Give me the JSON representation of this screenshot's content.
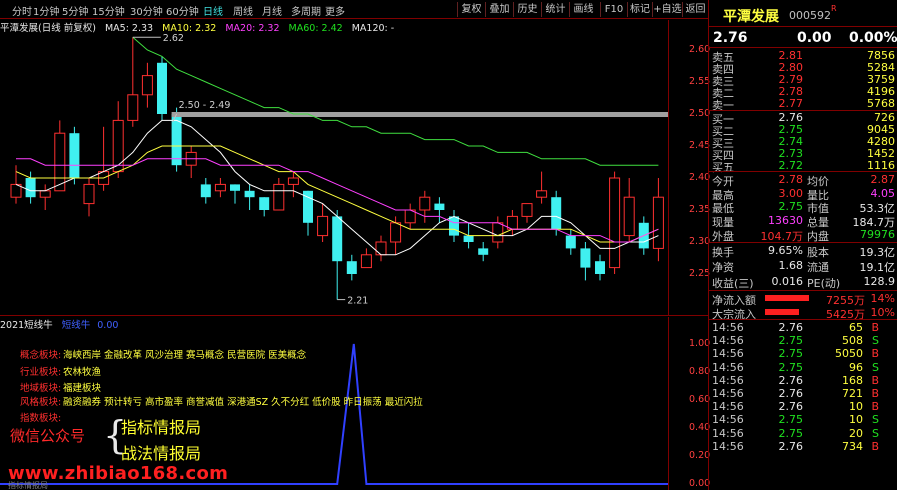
{
  "toolbar": {
    "periods": [
      "分时",
      "1分钟",
      "5分钟",
      "15分钟",
      "30分钟",
      "60分钟",
      "日线",
      "周线",
      "月线",
      "多周期",
      "更多"
    ],
    "active_period": "日线",
    "right_buttons": [
      "复权",
      "叠加",
      "历史",
      "统计",
      "画线",
      "F10",
      "标记",
      "+自选",
      "返回"
    ]
  },
  "ma_line": {
    "title": "平潭发展(日线 前复权)",
    "ma5": "MA5: 2.33",
    "ma10": "MA10: 2.32",
    "ma20": "MA20: 2.32",
    "ma60": "MA60: 2.42",
    "ma120": "MA120: -"
  },
  "price_axis": [
    "2.60",
    "2.55",
    "2.50",
    "2.45",
    "2.40",
    "2.35",
    "2.30",
    "2.25"
  ],
  "annotations": {
    "high": "2.62",
    "range": "2.50 - 2.49",
    "low": "2.21"
  },
  "colors": {
    "up": "#ff3030",
    "down": "#40f0f0",
    "ma5": "#ffffff",
    "ma10": "#ffff40",
    "ma20": "#ff40ff",
    "ma60": "#40e040"
  },
  "candles": [
    {
      "o": 2.37,
      "c": 2.39,
      "h": 2.42,
      "l": 2.36
    },
    {
      "o": 2.4,
      "c": 2.37,
      "h": 2.41,
      "l": 2.36
    },
    {
      "o": 2.37,
      "c": 2.38,
      "h": 2.39,
      "l": 2.35
    },
    {
      "o": 2.38,
      "c": 2.47,
      "h": 2.49,
      "l": 2.38
    },
    {
      "o": 2.47,
      "c": 2.4,
      "h": 2.48,
      "l": 2.39
    },
    {
      "o": 2.36,
      "c": 2.39,
      "h": 2.4,
      "l": 2.34
    },
    {
      "o": 2.39,
      "c": 2.41,
      "h": 2.48,
      "l": 2.38
    },
    {
      "o": 2.41,
      "c": 2.49,
      "h": 2.52,
      "l": 2.4
    },
    {
      "o": 2.49,
      "c": 2.53,
      "h": 2.62,
      "l": 2.48
    },
    {
      "o": 2.53,
      "c": 2.56,
      "h": 2.58,
      "l": 2.51
    },
    {
      "o": 2.58,
      "c": 2.5,
      "h": 2.59,
      "l": 2.49
    },
    {
      "o": 2.5,
      "c": 2.42,
      "h": 2.51,
      "l": 2.41
    },
    {
      "o": 2.42,
      "c": 2.44,
      "h": 2.45,
      "l": 2.4
    },
    {
      "o": 2.39,
      "c": 2.37,
      "h": 2.4,
      "l": 2.36
    },
    {
      "o": 2.38,
      "c": 2.39,
      "h": 2.4,
      "l": 2.37
    },
    {
      "o": 2.39,
      "c": 2.38,
      "h": 2.39,
      "l": 2.36
    },
    {
      "o": 2.38,
      "c": 2.37,
      "h": 2.39,
      "l": 2.35
    },
    {
      "o": 2.37,
      "c": 2.35,
      "h": 2.37,
      "l": 2.34
    },
    {
      "o": 2.35,
      "c": 2.39,
      "h": 2.4,
      "l": 2.35
    },
    {
      "o": 2.39,
      "c": 2.4,
      "h": 2.41,
      "l": 2.37
    },
    {
      "o": 2.38,
      "c": 2.33,
      "h": 2.38,
      "l": 2.31
    },
    {
      "o": 2.31,
      "c": 2.34,
      "h": 2.36,
      "l": 2.3
    },
    {
      "o": 2.34,
      "c": 2.27,
      "h": 2.35,
      "l": 2.21
    },
    {
      "o": 2.27,
      "c": 2.25,
      "h": 2.28,
      "l": 2.24
    },
    {
      "o": 2.26,
      "c": 2.28,
      "h": 2.29,
      "l": 2.26
    },
    {
      "o": 2.28,
      "c": 2.3,
      "h": 2.31,
      "l": 2.27
    },
    {
      "o": 2.3,
      "c": 2.33,
      "h": 2.34,
      "l": 2.28
    },
    {
      "o": 2.33,
      "c": 2.35,
      "h": 2.36,
      "l": 2.32
    },
    {
      "o": 2.35,
      "c": 2.37,
      "h": 2.38,
      "l": 2.33
    },
    {
      "o": 2.36,
      "c": 2.35,
      "h": 2.37,
      "l": 2.33
    },
    {
      "o": 2.34,
      "c": 2.31,
      "h": 2.35,
      "l": 2.3
    },
    {
      "o": 2.31,
      "c": 2.3,
      "h": 2.33,
      "l": 2.29
    },
    {
      "o": 2.29,
      "c": 2.28,
      "h": 2.3,
      "l": 2.27
    },
    {
      "o": 2.3,
      "c": 2.33,
      "h": 2.34,
      "l": 2.29
    },
    {
      "o": 2.32,
      "c": 2.34,
      "h": 2.35,
      "l": 2.31
    },
    {
      "o": 2.34,
      "c": 2.36,
      "h": 2.36,
      "l": 2.33
    },
    {
      "o": 2.37,
      "c": 2.38,
      "h": 2.41,
      "l": 2.36
    },
    {
      "o": 2.37,
      "c": 2.32,
      "h": 2.38,
      "l": 2.31
    },
    {
      "o": 2.31,
      "c": 2.29,
      "h": 2.32,
      "l": 2.28
    },
    {
      "o": 2.29,
      "c": 2.26,
      "h": 2.3,
      "l": 2.24
    },
    {
      "o": 2.27,
      "c": 2.25,
      "h": 2.28,
      "l": 2.24
    },
    {
      "o": 2.26,
      "c": 2.4,
      "h": 2.41,
      "l": 2.25
    },
    {
      "o": 2.31,
      "c": 2.37,
      "h": 2.4,
      "l": 2.3
    },
    {
      "o": 2.33,
      "c": 2.29,
      "h": 2.34,
      "l": 2.28
    },
    {
      "o": 2.29,
      "c": 2.37,
      "h": 2.4,
      "l": 2.27
    }
  ],
  "ma_lines": {
    "ma5": [
      2.39,
      2.38,
      2.38,
      2.39,
      2.4,
      2.4,
      2.41,
      2.42,
      2.44,
      2.47,
      2.49,
      2.49,
      2.48,
      2.46,
      2.44,
      2.41,
      2.39,
      2.38,
      2.38,
      2.38,
      2.37,
      2.36,
      2.34,
      2.32,
      2.3,
      2.28,
      2.28,
      2.29,
      2.31,
      2.33,
      2.34,
      2.33,
      2.32,
      2.31,
      2.31,
      2.32,
      2.34,
      2.34,
      2.33,
      2.31,
      2.29,
      2.29,
      2.3,
      2.3,
      2.31
    ],
    "ma10": [
      2.41,
      2.4,
      2.4,
      2.4,
      2.4,
      2.4,
      2.4,
      2.41,
      2.42,
      2.44,
      2.45,
      2.45,
      2.45,
      2.45,
      2.45,
      2.44,
      2.43,
      2.42,
      2.41,
      2.41,
      2.39,
      2.38,
      2.37,
      2.36,
      2.35,
      2.34,
      2.33,
      2.32,
      2.32,
      2.32,
      2.32,
      2.31,
      2.31,
      2.31,
      2.32,
      2.32,
      2.32,
      2.32,
      2.32,
      2.31,
      2.3,
      2.3,
      2.3,
      2.31,
      2.32
    ],
    "ma20": [
      2.43,
      2.43,
      2.42,
      2.42,
      2.42,
      2.42,
      2.42,
      2.42,
      2.42,
      2.43,
      2.43,
      2.43,
      2.43,
      2.43,
      2.42,
      2.42,
      2.42,
      2.42,
      2.42,
      2.41,
      2.41,
      2.4,
      2.39,
      2.38,
      2.37,
      2.36,
      2.35,
      2.35,
      2.34,
      2.34,
      2.33,
      2.33,
      2.33,
      2.33,
      2.32,
      2.32,
      2.32,
      2.32,
      2.31,
      2.31,
      2.31,
      2.3,
      2.3,
      2.31,
      2.32
    ],
    "ma60": [
      null,
      null,
      null,
      null,
      null,
      null,
      null,
      null,
      2.62,
      2.6,
      2.59,
      2.57,
      2.56,
      2.55,
      2.54,
      2.53,
      2.52,
      2.51,
      2.51,
      2.5,
      2.5,
      2.49,
      2.49,
      2.48,
      2.48,
      2.47,
      2.47,
      2.47,
      2.46,
      2.46,
      2.46,
      2.45,
      2.45,
      2.44,
      2.44,
      2.44,
      2.43,
      2.43,
      2.43,
      2.43,
      2.42,
      2.42,
      2.42,
      2.42,
      2.42
    ]
  },
  "indicator": {
    "name": "2021短线牛",
    "sub_label": "短线牛",
    "value": "0.00",
    "axis": [
      "1.00",
      "0.80",
      "0.60",
      "0.40",
      "0.20",
      "0.00"
    ],
    "values": [
      0,
      0,
      0,
      0,
      0,
      0,
      0,
      0,
      0,
      0,
      0,
      0,
      0,
      0,
      0,
      0,
      0,
      0,
      0,
      0,
      0,
      0,
      0,
      1,
      0,
      0,
      0,
      0,
      0,
      0,
      0,
      0,
      0,
      0,
      0,
      0,
      0,
      0,
      0,
      0,
      0,
      0,
      0,
      0,
      0
    ]
  },
  "sectors": [
    {
      "label": "概念板块:",
      "value": "海峡西岸 金融改革 风沙治理 赛马概念 民营医院 医美概念"
    },
    {
      "label": "行业板块:",
      "value": "农林牧渔"
    },
    {
      "label": "地域板块:",
      "value": "福建板块"
    },
    {
      "label": "风格板块:",
      "value": "融资融券 预计转亏 高市盈率 商誉减值 深港通SZ 久不分红 低价股 昨日振荡 最近闪拉"
    },
    {
      "label": "指数板块:",
      "value": ""
    }
  ],
  "ad": {
    "wechat": "微信公众号",
    "line1": "指标情报局",
    "line2": "战法情报局",
    "url": "www.zhibiao168.com",
    "sub": "指标情报局"
  },
  "stock": {
    "name": "平潭发展",
    "code": "000592",
    "mark": "R",
    "price": "2.76",
    "change": "0.00",
    "change_pct": "0.00%"
  },
  "order_book": [
    {
      "label": "卖五",
      "price": "2.81",
      "vol": "7856",
      "cls": "red"
    },
    {
      "label": "卖四",
      "price": "2.80",
      "vol": "5284",
      "cls": "red"
    },
    {
      "label": "卖三",
      "price": "2.79",
      "vol": "3759",
      "cls": "red"
    },
    {
      "label": "卖二",
      "price": "2.78",
      "vol": "4196",
      "cls": "red"
    },
    {
      "label": "卖一",
      "price": "2.77",
      "vol": "5768",
      "cls": "red"
    },
    {
      "label": "买一",
      "price": "2.76",
      "vol": "726",
      "cls": "white"
    },
    {
      "label": "买二",
      "price": "2.75",
      "vol": "9045",
      "cls": "green"
    },
    {
      "label": "买三",
      "price": "2.74",
      "vol": "4280",
      "cls": "green"
    },
    {
      "label": "买四",
      "price": "2.73",
      "vol": "1452",
      "cls": "green"
    },
    {
      "label": "买五",
      "price": "2.72",
      "vol": "1116",
      "cls": "green"
    }
  ],
  "stats": [
    {
      "l1": "今开",
      "v1": "2.78",
      "c1": "red",
      "l2": "均价",
      "v2": "2.87",
      "c2": "red"
    },
    {
      "l1": "最高",
      "v1": "3.00",
      "c1": "red",
      "l2": "量比",
      "v2": "4.05",
      "c2": "mag"
    },
    {
      "l1": "最低",
      "v1": "2.75",
      "c1": "green",
      "l2": "市值",
      "v2": "53.3亿",
      "c2": "white"
    },
    {
      "l1": "现量",
      "v1": "13630",
      "c1": "mag",
      "l2": "总量",
      "v2": "184.7万",
      "c2": "white"
    },
    {
      "l1": "外盘",
      "v1": "104.7万",
      "c1": "red",
      "l2": "内盘",
      "v2": "79976",
      "c2": "green"
    }
  ],
  "stats2": [
    {
      "l1": "换手",
      "v1": "9.65%",
      "c1": "white",
      "l2": "股本",
      "v2": "19.3亿",
      "c2": "white"
    },
    {
      "l1": "净资",
      "v1": "1.68",
      "c1": "white",
      "l2": "流通",
      "v2": "19.1亿",
      "c2": "white"
    },
    {
      "l1": "收益(三)",
      "v1": "0.016",
      "c1": "white",
      "l2": "PE(动)",
      "v2": "128.9",
      "c2": "white"
    }
  ],
  "flow": [
    {
      "label": "净流入额",
      "value": "7255万",
      "pct": "14%",
      "bar": 0.55
    },
    {
      "label": "大宗流入",
      "value": "5425万",
      "pct": "10%",
      "bar": 0.42
    }
  ],
  "ticks": [
    {
      "t": "14:56",
      "p": "2.76",
      "v": "65",
      "s": "B"
    },
    {
      "t": "14:56",
      "p": "2.75",
      "v": "508",
      "s": "S"
    },
    {
      "t": "14:56",
      "p": "2.75",
      "v": "5050",
      "s": "B"
    },
    {
      "t": "14:56",
      "p": "2.75",
      "v": "96",
      "s": "S"
    },
    {
      "t": "14:56",
      "p": "2.76",
      "v": "168",
      "s": "B"
    },
    {
      "t": "14:56",
      "p": "2.76",
      "v": "721",
      "s": "B"
    },
    {
      "t": "14:56",
      "p": "2.76",
      "v": "10",
      "s": "B"
    },
    {
      "t": "14:56",
      "p": "2.75",
      "v": "10",
      "s": "S"
    },
    {
      "t": "14:56",
      "p": "2.75",
      "v": "20",
      "s": "S"
    },
    {
      "t": "14:56",
      "p": "2.76",
      "v": "734",
      "s": "B"
    }
  ]
}
